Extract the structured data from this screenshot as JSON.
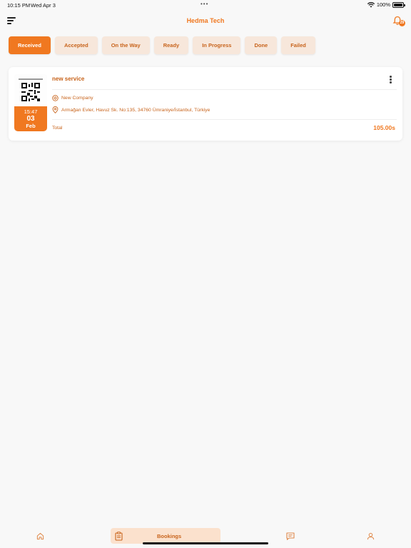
{
  "status_bar": {
    "time": "10:15 PM",
    "date": "Wed Apr 3",
    "dots": "•••",
    "battery_text": "100%",
    "battery_level": 1.0
  },
  "header": {
    "title": "Hedma Tech",
    "notification_count": "29",
    "menu_icon": "hamburger-sort-icon",
    "bell_icon": "bell-icon"
  },
  "tabs": [
    {
      "label": "Received",
      "active": true
    },
    {
      "label": "Accepted",
      "active": false
    },
    {
      "label": "On the Way",
      "active": false
    },
    {
      "label": "Ready",
      "active": false
    },
    {
      "label": "In Progress",
      "active": false
    },
    {
      "label": "Done",
      "active": false
    },
    {
      "label": "Failed",
      "active": false
    }
  ],
  "booking": {
    "title": "new service",
    "time": "15:47",
    "day": "03",
    "month": "Feb",
    "company": "New Company",
    "address": "Armağan Evler, Havuz Sk. No:135, 34760 Ümraniye/İstanbul, Türkiye",
    "total_label": "Total",
    "total_value": "105.00s"
  },
  "bottom_nav": {
    "items": [
      {
        "name": "home",
        "icon": "home-icon",
        "label": ""
      },
      {
        "name": "bookings",
        "icon": "clipboard-icon",
        "label": "Bookings",
        "active": true
      },
      {
        "name": "messages",
        "icon": "chat-icon",
        "label": ""
      },
      {
        "name": "profile",
        "icon": "user-icon",
        "label": ""
      }
    ]
  },
  "colors": {
    "accent": "#f07820",
    "accent_text": "#c8641c",
    "tab_bg": "#f7e7db",
    "nav_active_bg": "#fbe1cd",
    "background": "#f8f8f8"
  }
}
